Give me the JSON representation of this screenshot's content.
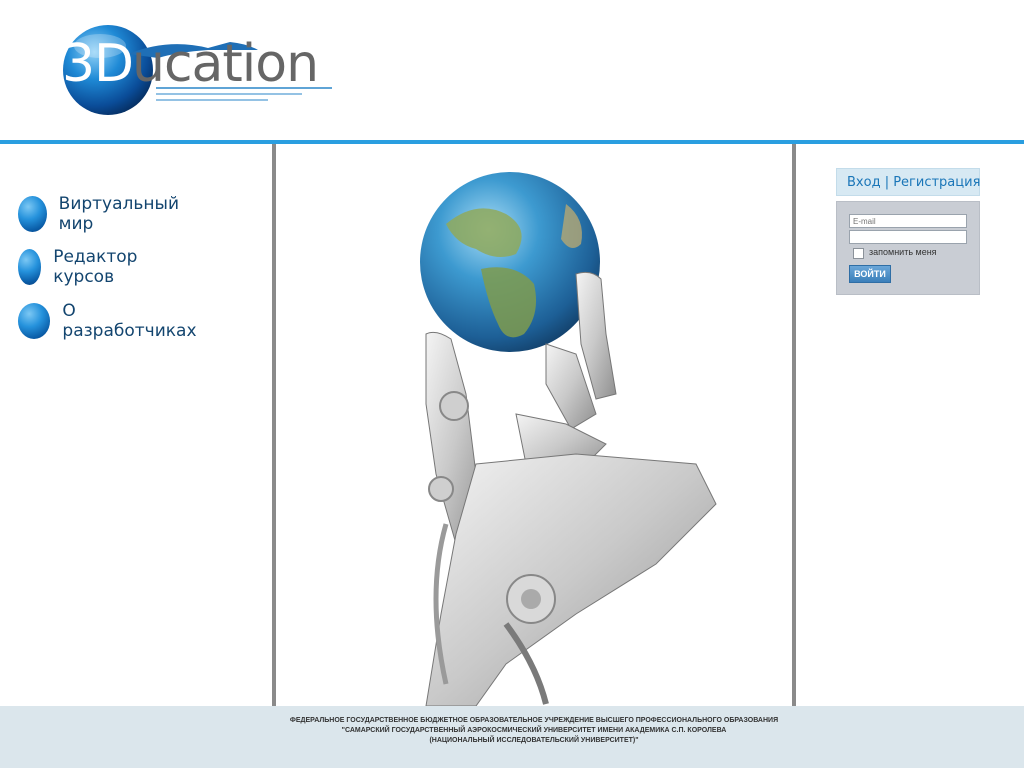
{
  "logo": {
    "prefix": "3",
    "highlight": "D",
    "rest": "ucation"
  },
  "nav": {
    "items": [
      {
        "label": "Виртуальный мир"
      },
      {
        "label": "Редактор курсов"
      },
      {
        "label": "О разработчиках"
      }
    ]
  },
  "login": {
    "tab_login": "Вход",
    "tab_sep": " | ",
    "tab_register": "Регистрация",
    "email_placeholder": "E-mail",
    "password_value": "",
    "remember_label": "запомнить меня",
    "submit_label": "ВОЙТИ"
  },
  "footer": {
    "line1": "ФЕДЕРАЛЬНОЕ ГОСУДАРСТВЕННОЕ БЮДЖЕТНОЕ ОБРАЗОВАТЕЛЬНОЕ УЧРЕЖДЕНИЕ ВЫСШЕГО ПРОФЕССИОНАЛЬНОГО ОБРАЗОВАНИЯ",
    "line2": "\"САМАРСКИЙ ГОСУДАРСТВЕННЫЙ АЭРОКОСМИЧЕСКИЙ УНИВЕРСИТЕТ ИМЕНИ АКАДЕМИКА С.П. КОРОЛЕВА",
    "line3": "(НАЦИОНАЛЬНЫЙ ИССЛЕДОВАТЕЛЬСКИЙ УНИВЕРСИТЕТ)\""
  },
  "colors": {
    "accent": "#2a9ee0",
    "nav_text": "#13456f",
    "footer_bg": "#dbe6ec"
  }
}
